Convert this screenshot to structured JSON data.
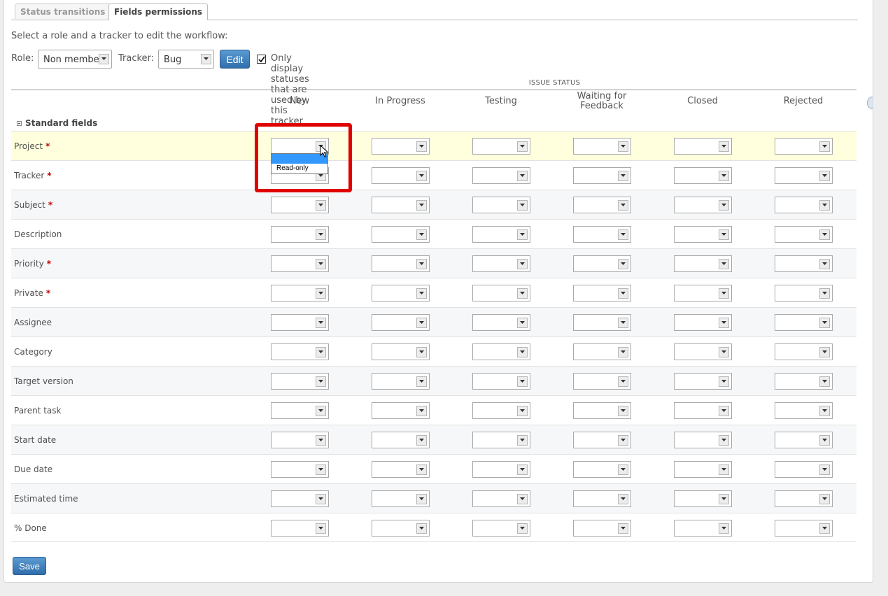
{
  "tabs": [
    {
      "label": "Status transitions",
      "active": false
    },
    {
      "label": "Fields permissions",
      "active": true
    }
  ],
  "intro_text": "Select a role and a tracker to edit the workflow:",
  "filters": {
    "role_label": "Role:",
    "role_value": "Non member",
    "tracker_label": "Tracker:",
    "tracker_value": "Bug",
    "edit_label": "Edit",
    "only_used_checked": true,
    "only_used_label": "Only display statuses that are used by this tracker"
  },
  "table": {
    "group_header": "ISSUE STATUS",
    "statuses": [
      "New",
      "In Progress",
      "Testing",
      "Waiting for Feedback",
      "Closed",
      "Rejected"
    ],
    "section_label": "Standard fields",
    "required_marker": "*",
    "fields": [
      {
        "label": "Project",
        "required": true
      },
      {
        "label": "Tracker",
        "required": true
      },
      {
        "label": "Subject",
        "required": true
      },
      {
        "label": "Description",
        "required": false
      },
      {
        "label": "Priority",
        "required": true
      },
      {
        "label": "Private",
        "required": true
      },
      {
        "label": "Assignee",
        "required": false
      },
      {
        "label": "Category",
        "required": false
      },
      {
        "label": "Target version",
        "required": false
      },
      {
        "label": "Parent task",
        "required": false
      },
      {
        "label": "Start date",
        "required": false
      },
      {
        "label": "Due date",
        "required": false
      },
      {
        "label": "Estimated time",
        "required": false
      },
      {
        "label": "% Done",
        "required": false
      }
    ]
  },
  "dropdown": {
    "options": [
      "",
      "Read-only"
    ],
    "highlighted_index": 0
  },
  "save_label": "Save",
  "colors": {
    "highlight_box": "#e00000",
    "button_blue": "#2f6eab",
    "selected_option": "#3399ff",
    "highlight_row": "#ffffdd",
    "required": "#bb0000"
  }
}
